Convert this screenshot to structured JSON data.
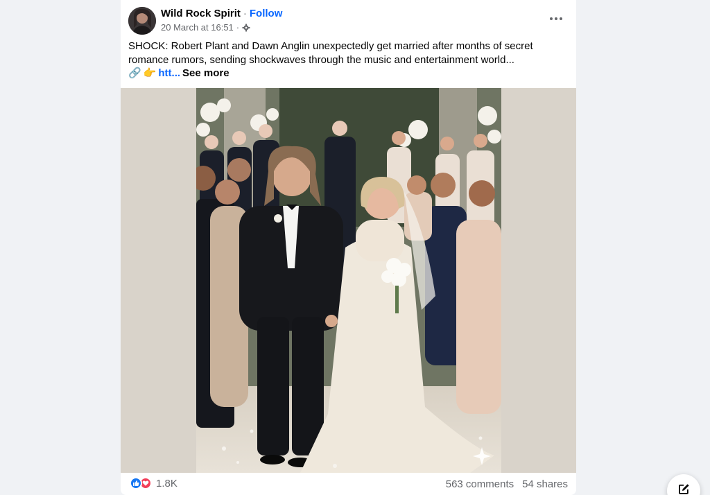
{
  "post": {
    "author": "Wild Rock Spirit",
    "separator": "·",
    "follow_label": "Follow",
    "timestamp": "20 March at 16:51",
    "meta_separator": "·",
    "privacy_icon": "gear-icon",
    "more_icon": "more-horizontal-icon",
    "text_line1": "SHOCK: Robert Plant and Dawn Anglin unexpectedly get married after months of secret romance rumors, sending shockwaves through the music and entertainment world...",
    "emoji_link": "🔗",
    "emoji_point": "👉",
    "link_text": "htt...",
    "see_more_label": "See more",
    "image_icon": "sparkle-icon"
  },
  "footer": {
    "reaction_icons": [
      "like-icon",
      "love-icon"
    ],
    "reaction_count": "1.8K",
    "comments": "563 comments",
    "shares": "54 shares"
  },
  "colors": {
    "accent": "#0866ff",
    "like": "#1877f2",
    "love": "#f33e58",
    "media_bg": "#d9d3ca",
    "page_bg": "#f0f2f5"
  }
}
